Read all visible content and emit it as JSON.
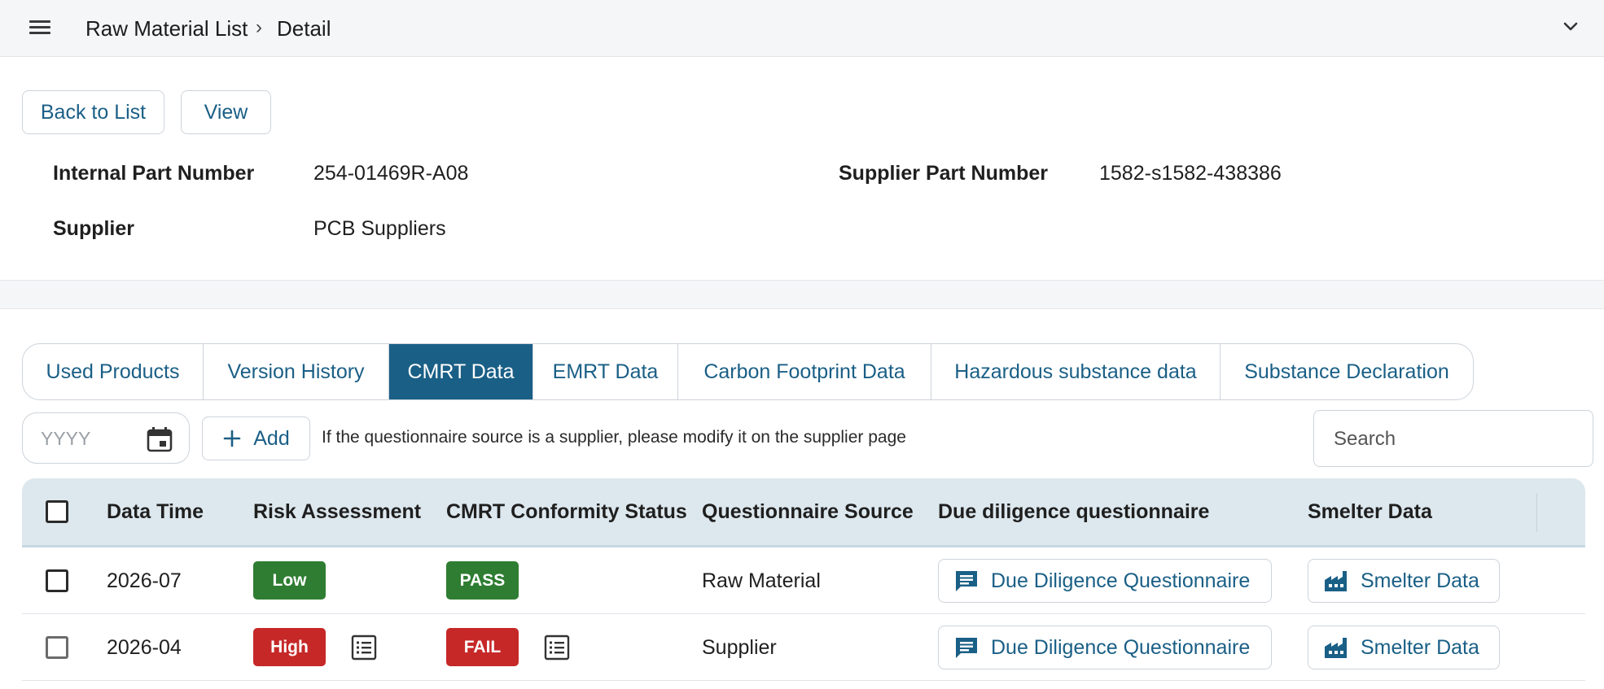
{
  "header": {
    "breadcrumb_root": "Raw Material List",
    "breadcrumb_separator": "›",
    "breadcrumb_current": "Detail"
  },
  "actions": {
    "back_label": "Back to List",
    "view_label": "View"
  },
  "info": {
    "internal_part_label": "Internal Part Number",
    "internal_part_value": "254-01469R-A08",
    "supplier_part_label": "Supplier Part Number",
    "supplier_part_value": "1582-s1582-438386",
    "supplier_label": "Supplier",
    "supplier_value": "PCB Suppliers"
  },
  "tabs": [
    {
      "label": "Used Products",
      "active": false
    },
    {
      "label": "Version History",
      "active": false
    },
    {
      "label": "CMRT Data",
      "active": true
    },
    {
      "label": "EMRT Data",
      "active": false
    },
    {
      "label": "Carbon Footprint Data",
      "active": false
    },
    {
      "label": "Hazardous substance data",
      "active": false
    },
    {
      "label": "Substance Declaration",
      "active": false
    }
  ],
  "toolbar": {
    "date_placeholder": "YYYY",
    "add_label": "Add",
    "hint": "If the questionnaire source is a supplier, please modify it on the supplier page",
    "search_placeholder": "Search"
  },
  "table": {
    "headers": {
      "data_time": "Data Time",
      "risk": "Risk Assessment",
      "conformity": "CMRT Conformity Status",
      "source": "Questionnaire Source",
      "questionnaire": "Due diligence questionnaire",
      "smelter": "Smelter Data"
    },
    "rows": [
      {
        "data_time": "2026-07",
        "risk": "Low",
        "conformity": "PASS",
        "source": "Raw Material",
        "questionnaire": "Due Diligence Questionnaire",
        "smelter": "Smelter Data"
      },
      {
        "data_time": "2026-04",
        "risk": "High",
        "conformity": "FAIL",
        "source": "Supplier",
        "questionnaire": "Due Diligence Questionnaire",
        "smelter": "Smelter Data"
      }
    ]
  },
  "colors": {
    "primary": "#1a5f86",
    "success": "#2e7d32",
    "danger": "#c62828",
    "header_bg": "#dde8ee"
  },
  "icons": [
    "menu-icon",
    "chevron-down-icon",
    "calendar-icon",
    "plus-icon",
    "list-icon",
    "chat-icon",
    "factory-icon"
  ]
}
